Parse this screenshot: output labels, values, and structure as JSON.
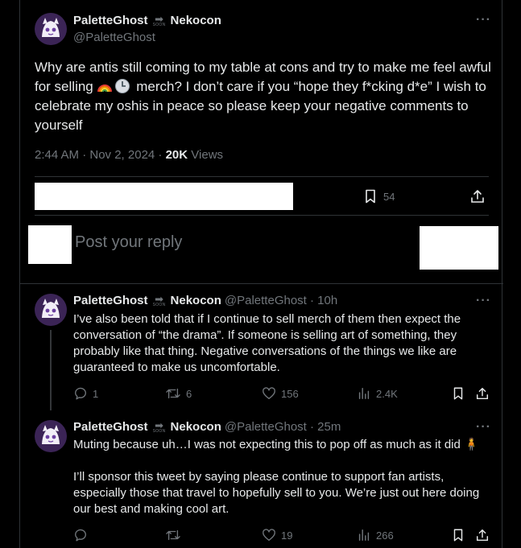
{
  "main_tweet": {
    "display_name": "PaletteGhost",
    "name_suffix": "Nekocon",
    "soon_label": "SOON",
    "handle": "@PaletteGhost",
    "text_before_emoji": "Why are antis still coming to my table at cons and try to make me feel awful for selling ",
    "text_after_emoji": " merch? I don’t care if you “hope they f*cking d*e” I wish to celebrate my oshis in peace so please keep your negative comments to yourself",
    "time": "2:44 AM · Nov 2, 2024 · ",
    "views_count": "20K",
    "views_label": " Views",
    "bookmarks": "54"
  },
  "reply_box": {
    "placeholder": "Post your reply"
  },
  "replies": [
    {
      "display_name": "PaletteGhost",
      "name_suffix": "Nekocon",
      "soon_label": "SOON",
      "handle_time": "@PaletteGhost · 10h",
      "text": "I’ve also been told that if I continue to sell merch of them then expect the conversation of “the drama”. If someone is selling art of something, they probably like that thing. Negative conversations of the things we like are guaranteed to make us uncomfortable.",
      "replies": "1",
      "reposts": "6",
      "likes": "156",
      "views": "2.4K"
    },
    {
      "display_name": "PaletteGhost",
      "name_suffix": "Nekocon",
      "soon_label": "SOON",
      "handle_time": "@PaletteGhost · 25m",
      "text_line1": "Muting because uh…I was not expecting this to pop off as much as it did 🧍",
      "text_para2": "I’ll sponsor this tweet by saying please continue to support fan artists, especially those that travel to hopefully sell to you. We’re just out here doing our best and making cool art.",
      "replies": "",
      "reposts": "",
      "likes": "19",
      "views": "266"
    }
  ],
  "colors": {
    "background": "#000000",
    "text": "#e7e9ea",
    "muted": "#71767b",
    "border": "#2f3336"
  }
}
